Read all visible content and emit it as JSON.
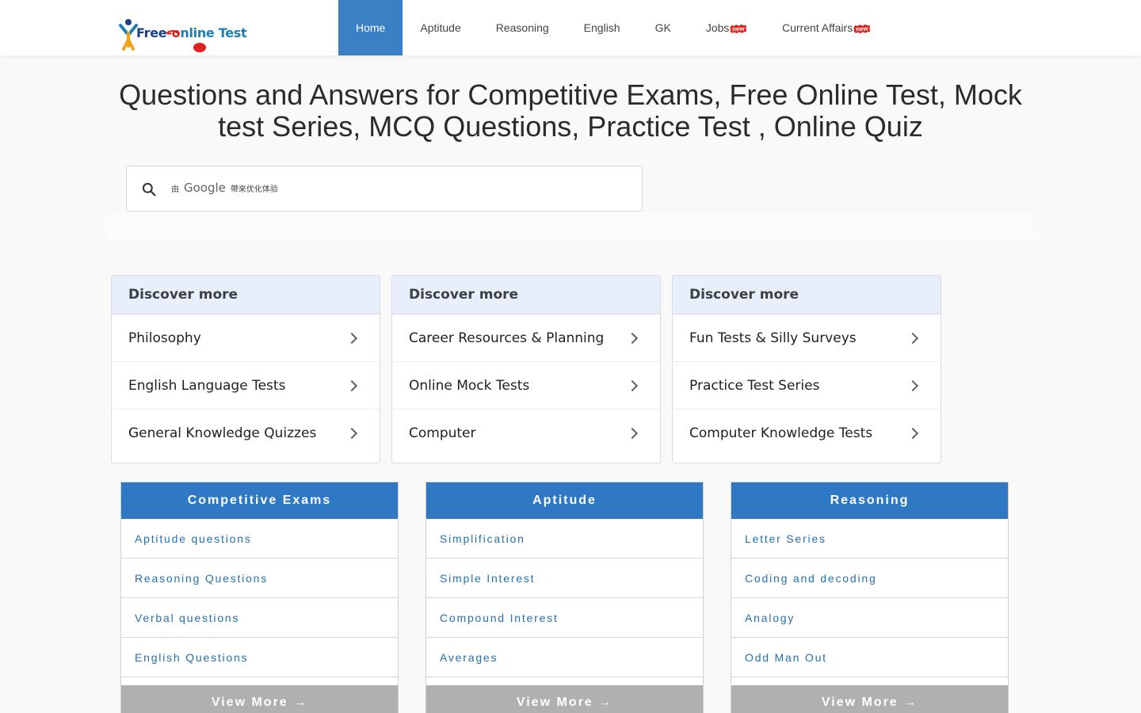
{
  "header": {
    "logo_text_a": "Free",
    "logo_text_b": "nline Test",
    "nav": [
      {
        "label": "Home"
      },
      {
        "label": "Aptitude"
      },
      {
        "label": "Reasoning"
      },
      {
        "label": "English"
      },
      {
        "label": "GK"
      },
      {
        "label": "Jobs",
        "badge": "new"
      },
      {
        "label": "Current Affairs",
        "badge": "new"
      }
    ]
  },
  "title": "Questions and Answers for Competitive Exams, Free Online Test, Mock test Series, MCQ Questions, Practice Test , Online Quiz",
  "search": {
    "branding_pre": "由",
    "branding_google": "Google",
    "branding_post": "帶來优化体验"
  },
  "discover": [
    {
      "heading": "Discover more",
      "items": [
        "Philosophy",
        "English Language Tests",
        "General Knowledge Quizzes"
      ]
    },
    {
      "heading": "Discover more",
      "items": [
        "Career Resources & Planning",
        "Online Mock Tests",
        "Computer"
      ]
    },
    {
      "heading": "Discover more",
      "items": [
        "Fun Tests & Silly Surveys",
        "Practice Test Series",
        "Computer Knowledge Tests"
      ]
    }
  ],
  "cards": [
    {
      "title": "Competitive Exams",
      "items": [
        "Aptitude questions",
        "Reasoning Questions",
        "Verbal questions",
        "English Questions"
      ],
      "more": "View More →"
    },
    {
      "title": "Aptitude",
      "items": [
        "Simplification",
        "Simple Interest",
        "Compound Interest",
        "Averages"
      ],
      "more": "View More →"
    },
    {
      "title": "Reasoning",
      "items": [
        "Letter Series",
        "Coding and decoding",
        "Analogy",
        "Odd Man Out"
      ],
      "more": "View More →"
    }
  ],
  "colors": {
    "nav_active": "#3b7fc4",
    "card_header": "#2f78c4",
    "link": "#2570b0",
    "badge": "#e0201c"
  }
}
